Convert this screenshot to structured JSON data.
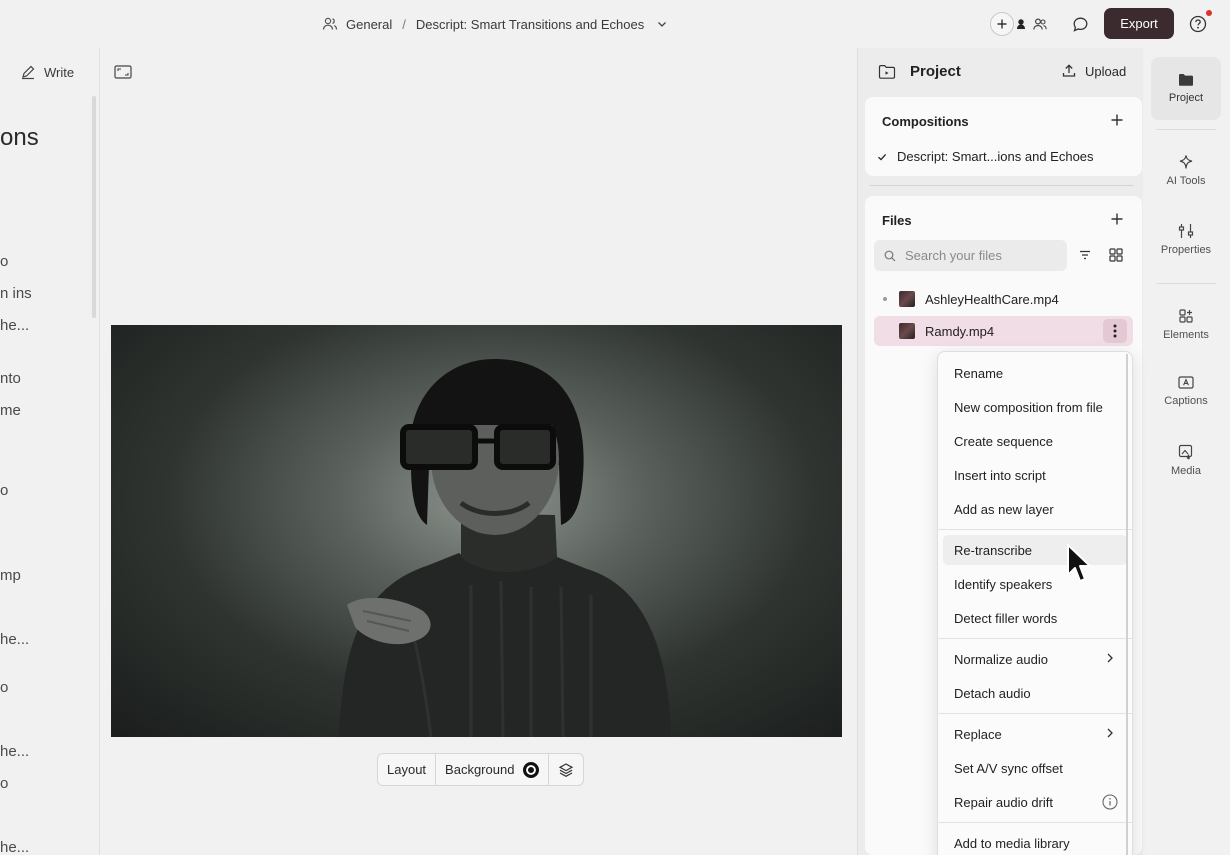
{
  "topbar": {
    "workspace": "General",
    "separator": "/",
    "project_name": "Descript: Smart Transitions and Echoes",
    "export_label": "Export",
    "icons": [
      "people-icon",
      "chevron-down-icon",
      "add-collaborator-icon",
      "avatar-icon",
      "team-icon",
      "comment-icon",
      "help-icon"
    ]
  },
  "script": {
    "write_label": "Write",
    "title": "ons",
    "lines": [
      "o",
      "n ins",
      "he...",
      "nto",
      " me",
      "o",
      "mp",
      "he...",
      "o",
      "he...",
      "o",
      "he..."
    ]
  },
  "video_toolbar": {
    "layout_label": "Layout",
    "background_label": "Background"
  },
  "project_panel": {
    "title": "Project",
    "upload_label": "Upload",
    "compositions": {
      "title": "Compositions",
      "items": [
        "Descript: Smart...ions and Echoes"
      ]
    },
    "files": {
      "title": "Files",
      "search_placeholder": "Search your files",
      "items": [
        "AshleyHealthCare.mp4",
        "Ramdy.mp4"
      ]
    }
  },
  "context_menu": {
    "items": [
      "Rename",
      "New composition from file",
      "Create sequence",
      "Insert into script",
      "Add as new layer",
      "Re-transcribe",
      "Identify speakers",
      "Detect filler words",
      "Normalize audio",
      "Detach audio",
      "Replace",
      "Set A/V sync offset",
      "Repair audio drift",
      "Add to media library"
    ]
  },
  "rail": {
    "items": [
      "Project",
      "AI Tools",
      "Properties",
      "Elements",
      "Captions",
      "Media"
    ]
  },
  "colors": {
    "export_bg": "#3b2a2e",
    "selected_row": "#f1dde6",
    "notification": "#e0302e"
  }
}
